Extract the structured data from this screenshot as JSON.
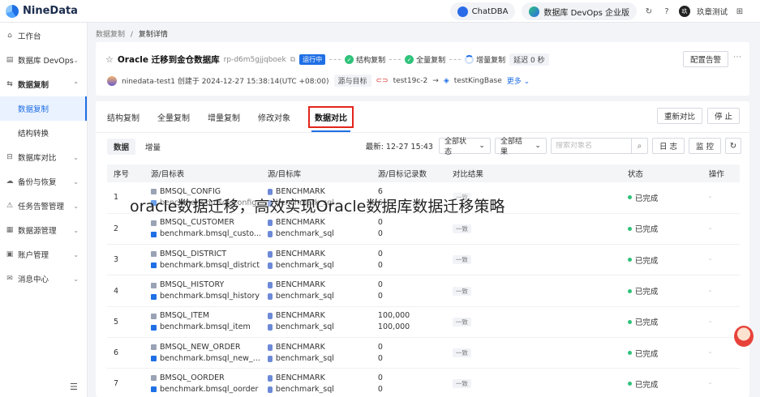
{
  "app": {
    "logo_text": "NineData"
  },
  "topbar": {
    "chatdba": "ChatDBA",
    "devops": "数据库 DevOps 企业版",
    "user": "玖章测试",
    "avatar": "玖"
  },
  "sidebar": {
    "items": [
      {
        "icon": "⌂",
        "label": "工作台",
        "chev": ""
      },
      {
        "icon": "▤",
        "label": "数据库 DevOps",
        "chev": "⌄"
      },
      {
        "icon": "⇆",
        "label": "数据复制",
        "chev": "⌃"
      },
      {
        "icon": "⊟",
        "label": "数据库对比",
        "chev": "⌄"
      },
      {
        "icon": "☁",
        "label": "备份与恢复",
        "chev": "⌄"
      },
      {
        "icon": "⚠",
        "label": "任务告警管理",
        "chev": "⌄"
      },
      {
        "icon": "▦",
        "label": "数据源管理",
        "chev": "⌄"
      },
      {
        "icon": "▣",
        "label": "账户管理",
        "chev": "⌄"
      },
      {
        "icon": "✉",
        "label": "消息中心",
        "chev": "⌄"
      }
    ],
    "sub_items": [
      "数据复制",
      "结构转换"
    ]
  },
  "breadcrumb": {
    "parent": "数据复制",
    "sep": "/",
    "current": "复制详情"
  },
  "task": {
    "title": "Oracle 迁移到金仓数据库",
    "rp": "rp-d6m5gjjqboek",
    "status": "运行中",
    "steps": [
      "结构复制",
      "全量复制",
      "增量复制"
    ],
    "delay_label": "延迟",
    "delay_value": "0 秒",
    "alarm_button": "配置告警",
    "creator": "ninedata-test1 创建于 2024-12-27 15:38:14(UTC +08:00)",
    "src_dst_label": "源与目标",
    "source": "test19c-2",
    "arrow": "→",
    "target": "testKingBase",
    "more": "更多"
  },
  "tabs": [
    "结构复制",
    "全量复制",
    "增量复制",
    "修改对象",
    "数据对比"
  ],
  "actions": {
    "recompare": "重新对比",
    "stop": "停 止"
  },
  "filters": {
    "seg": [
      "数据",
      "增量"
    ],
    "latest_label": "最新:",
    "latest_value": "12-27 15:43",
    "status_select": "全部状态",
    "result_select": "全部结果",
    "search_placeholder": "搜索对象名",
    "log_button": "日 志",
    "monitor_button": "监 控"
  },
  "table": {
    "headers": [
      "序号",
      "源/目标表",
      "源/目标库",
      "源/目标记录数",
      "对比结果",
      "状态",
      "操作"
    ],
    "rows": [
      {
        "no": "1",
        "src_table": "BMSQL_CONFIG",
        "dst_table": "benchmark.bmsql_config",
        "src_db": "BENCHMARK",
        "dst_db": "benchmark_sql",
        "src_count": "6",
        "dst_count": "6",
        "result": "一致",
        "status": "已完成",
        "op": "-"
      },
      {
        "no": "2",
        "src_table": "BMSQL_CUSTOMER",
        "dst_table": "benchmark.bmsql_custo...",
        "src_db": "BENCHMARK",
        "dst_db": "benchmark_sql",
        "src_count": "0",
        "dst_count": "0",
        "result": "一致",
        "status": "已完成",
        "op": "-"
      },
      {
        "no": "3",
        "src_table": "BMSQL_DISTRICT",
        "dst_table": "benchmark.bmsql_district",
        "src_db": "BENCHMARK",
        "dst_db": "benchmark_sql",
        "src_count": "0",
        "dst_count": "0",
        "result": "一致",
        "status": "已完成",
        "op": "-"
      },
      {
        "no": "4",
        "src_table": "BMSQL_HISTORY",
        "dst_table": "benchmark.bmsql_history",
        "src_db": "BENCHMARK",
        "dst_db": "benchmark_sql",
        "src_count": "0",
        "dst_count": "0",
        "result": "一致",
        "status": "已完成",
        "op": "-"
      },
      {
        "no": "5",
        "src_table": "BMSQL_ITEM",
        "dst_table": "benchmark.bmsql_item",
        "src_db": "BENCHMARK",
        "dst_db": "benchmark_sql",
        "src_count": "100,000",
        "dst_count": "100,000",
        "result": "一致",
        "status": "已完成",
        "op": "-"
      },
      {
        "no": "6",
        "src_table": "BMSQL_NEW_ORDER",
        "dst_table": "benchmark.bmsql_new_...",
        "src_db": "BENCHMARK",
        "dst_db": "benchmark_sql",
        "src_count": "0",
        "dst_count": "0",
        "result": "一致",
        "status": "已完成",
        "op": "-"
      },
      {
        "no": "7",
        "src_table": "BMSQL_OORDER",
        "dst_table": "benchmark.bmsql_oorder",
        "src_db": "BENCHMARK",
        "dst_db": "benchmark_sql",
        "src_count": "0",
        "dst_count": "0",
        "result": "一致",
        "status": "已完成",
        "op": "-"
      }
    ]
  },
  "overlay": "oracle数据迁移，高效实现Oracle数据库数据迁移策略"
}
